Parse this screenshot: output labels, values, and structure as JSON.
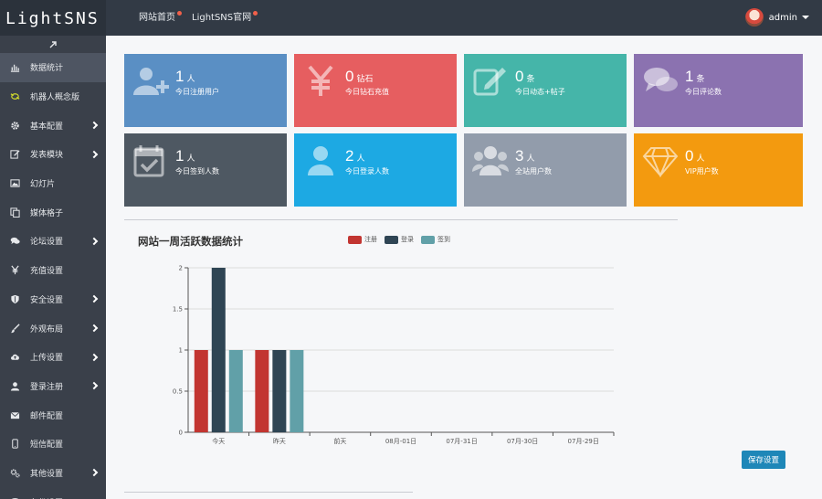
{
  "app": {
    "logo": "LightSNS"
  },
  "topnav": [
    {
      "label": "网站首页"
    },
    {
      "label": "LightSNS官网"
    }
  ],
  "user": {
    "name": "admin"
  },
  "sidebar": {
    "items": [
      {
        "label": "数据统计",
        "icon": "bar-chart-icon"
      },
      {
        "label": "机器人概念版",
        "icon": "robot-icon"
      },
      {
        "label": "基本配置",
        "icon": "gear-icon"
      },
      {
        "label": "发表模块",
        "icon": "edit-icon"
      },
      {
        "label": "幻灯片",
        "icon": "image-icon"
      },
      {
        "label": "媒体格子",
        "icon": "copy-icon"
      },
      {
        "label": "论坛设置",
        "icon": "comments-icon"
      },
      {
        "label": "充值设置",
        "icon": "yen-icon"
      },
      {
        "label": "安全设置",
        "icon": "shield-icon"
      },
      {
        "label": "外观布局",
        "icon": "brush-icon"
      },
      {
        "label": "上传设置",
        "icon": "cloud-upload-icon"
      },
      {
        "label": "登录注册",
        "icon": "user-icon"
      },
      {
        "label": "邮件配置",
        "icon": "envelope-icon"
      },
      {
        "label": "短信配置",
        "icon": "mobile-icon"
      },
      {
        "label": "其他设置",
        "icon": "cogs-icon"
      },
      {
        "label": "备份设置",
        "icon": "backup-icon"
      }
    ]
  },
  "stats": [
    {
      "value": "1",
      "unit": "人",
      "label": "今日注册用户",
      "color": "#5a8fc4",
      "icon": "user-add-icon"
    },
    {
      "value": "0",
      "unit": "钻石",
      "label": "今日钻石充值",
      "color": "#e65e60",
      "icon": "yen-icon"
    },
    {
      "value": "0",
      "unit": "条",
      "label": "今日动态+帖子",
      "color": "#45b5a9",
      "icon": "edit-icon"
    },
    {
      "value": "1",
      "unit": "条",
      "label": "今日评论数",
      "color": "#8b72b0",
      "icon": "comments-icon"
    },
    {
      "value": "1",
      "unit": "人",
      "label": "今日签到人数",
      "color": "#4e5862",
      "icon": "calendar-check-icon"
    },
    {
      "value": "2",
      "unit": "人",
      "label": "今日登录人数",
      "color": "#1da9e3",
      "icon": "user-icon"
    },
    {
      "value": "3",
      "unit": "人",
      "label": "全站用户数",
      "color": "#929cab",
      "icon": "users-icon"
    },
    {
      "value": "0",
      "unit": "人",
      "label": "VIP用户数",
      "color": "#f39a0f",
      "icon": "diamond-icon"
    }
  ],
  "chart_data": {
    "type": "bar",
    "title": "网站一周活跃数据统计",
    "categories": [
      "今天",
      "昨天",
      "前天",
      "08月-01日",
      "07月-31日",
      "07月-30日",
      "07月-29日"
    ],
    "series": [
      {
        "name": "注册",
        "color": "#c23531",
        "values": [
          1,
          1,
          0,
          0,
          0,
          0,
          0
        ]
      },
      {
        "name": "登录",
        "color": "#2f4554",
        "values": [
          2,
          1,
          0,
          0,
          0,
          0,
          0
        ]
      },
      {
        "name": "签到",
        "color": "#61a0a8",
        "values": [
          1,
          1,
          0,
          0,
          0,
          0,
          0
        ]
      }
    ],
    "ylim": [
      0,
      2
    ],
    "yticks": [
      "0",
      "0.5",
      "1",
      "1.5",
      "2"
    ],
    "grid": true,
    "legend": "top"
  },
  "actions": {
    "save_label": "保存设置"
  }
}
